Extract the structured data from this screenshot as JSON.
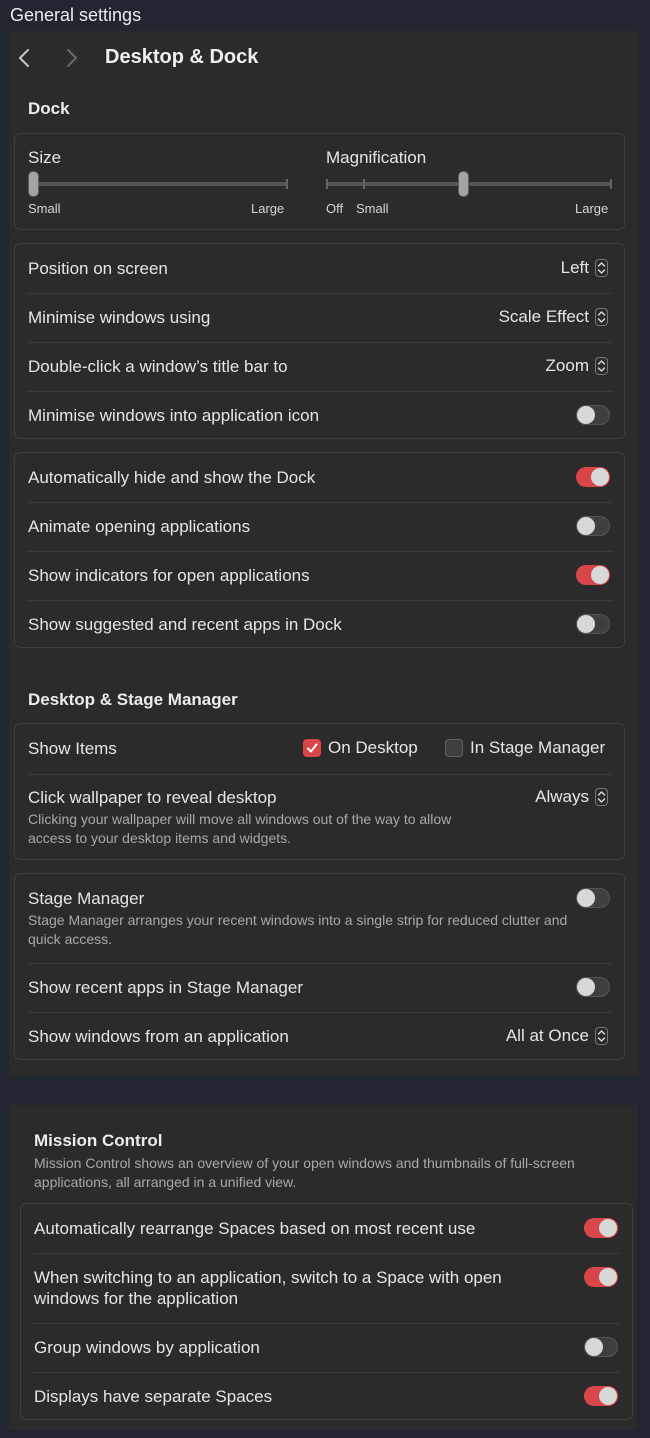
{
  "top_title": "General settings",
  "window": {
    "title": "Desktop & Dock"
  },
  "dock": {
    "title": "Dock",
    "size": {
      "label": "Size",
      "min_label": "Small",
      "max_label": "Large",
      "value_fraction": 0.0
    },
    "magnification": {
      "label": "Magnification",
      "off_label": "Off",
      "min_label": "Small",
      "max_label": "Large",
      "value_fraction": 0.4
    },
    "position": {
      "label": "Position on screen",
      "value": "Left"
    },
    "minimise_using": {
      "label": "Minimise windows using",
      "value": "Scale Effect"
    },
    "double_click": {
      "label": "Double-click a window’s title bar to",
      "value": "Zoom"
    },
    "minimise_into_icon": {
      "label": "Minimise windows into application icon",
      "on": false
    },
    "auto_hide": {
      "label": "Automatically hide and show the Dock",
      "on": true
    },
    "animate_opening": {
      "label": "Animate opening applications",
      "on": false
    },
    "show_indicators": {
      "label": "Show indicators for open applications",
      "on": true
    },
    "show_suggested": {
      "label": "Show suggested and recent apps in Dock",
      "on": false
    }
  },
  "desktop_stage": {
    "title": "Desktop & Stage Manager",
    "show_items": {
      "label": "Show Items",
      "on_desktop": "On Desktop",
      "on_desktop_checked": true,
      "in_stage_manager": "In Stage Manager",
      "in_stage_manager_checked": false
    },
    "click_wallpaper": {
      "label": "Click wallpaper to reveal desktop",
      "description": "Clicking your wallpaper will move all windows out of the way to allow access to your desktop items and widgets.",
      "value": "Always"
    },
    "stage_manager": {
      "label": "Stage Manager",
      "description": "Stage Manager arranges your recent windows into a single strip for reduced clutter and quick access.",
      "on": false
    },
    "show_recent_apps": {
      "label": "Show recent apps in Stage Manager",
      "on": false
    },
    "show_windows_from_app": {
      "label": "Show windows from an application",
      "value": "All at Once"
    }
  },
  "mission_control": {
    "title": "Mission Control",
    "description": "Mission Control shows an overview of your open windows and thumbnails of full-screen applications, all arranged in a unified view.",
    "auto_rearrange": {
      "label": "Automatically rearrange Spaces based on most recent use",
      "on": true
    },
    "switch_to_space": {
      "label": "When switching to an application, switch to a Space with open windows for the application",
      "on": true
    },
    "group_windows": {
      "label": "Group windows by application",
      "on": false
    },
    "separate_spaces": {
      "label": "Displays have separate Spaces",
      "on": true
    }
  },
  "colors": {
    "accent": "#d9464a",
    "panel": "#2b2b2b",
    "background": "#222630"
  },
  "icons": [
    "chevron-left-icon",
    "chevron-right-icon",
    "up-down-chevron-icon",
    "checkmark-icon"
  ]
}
